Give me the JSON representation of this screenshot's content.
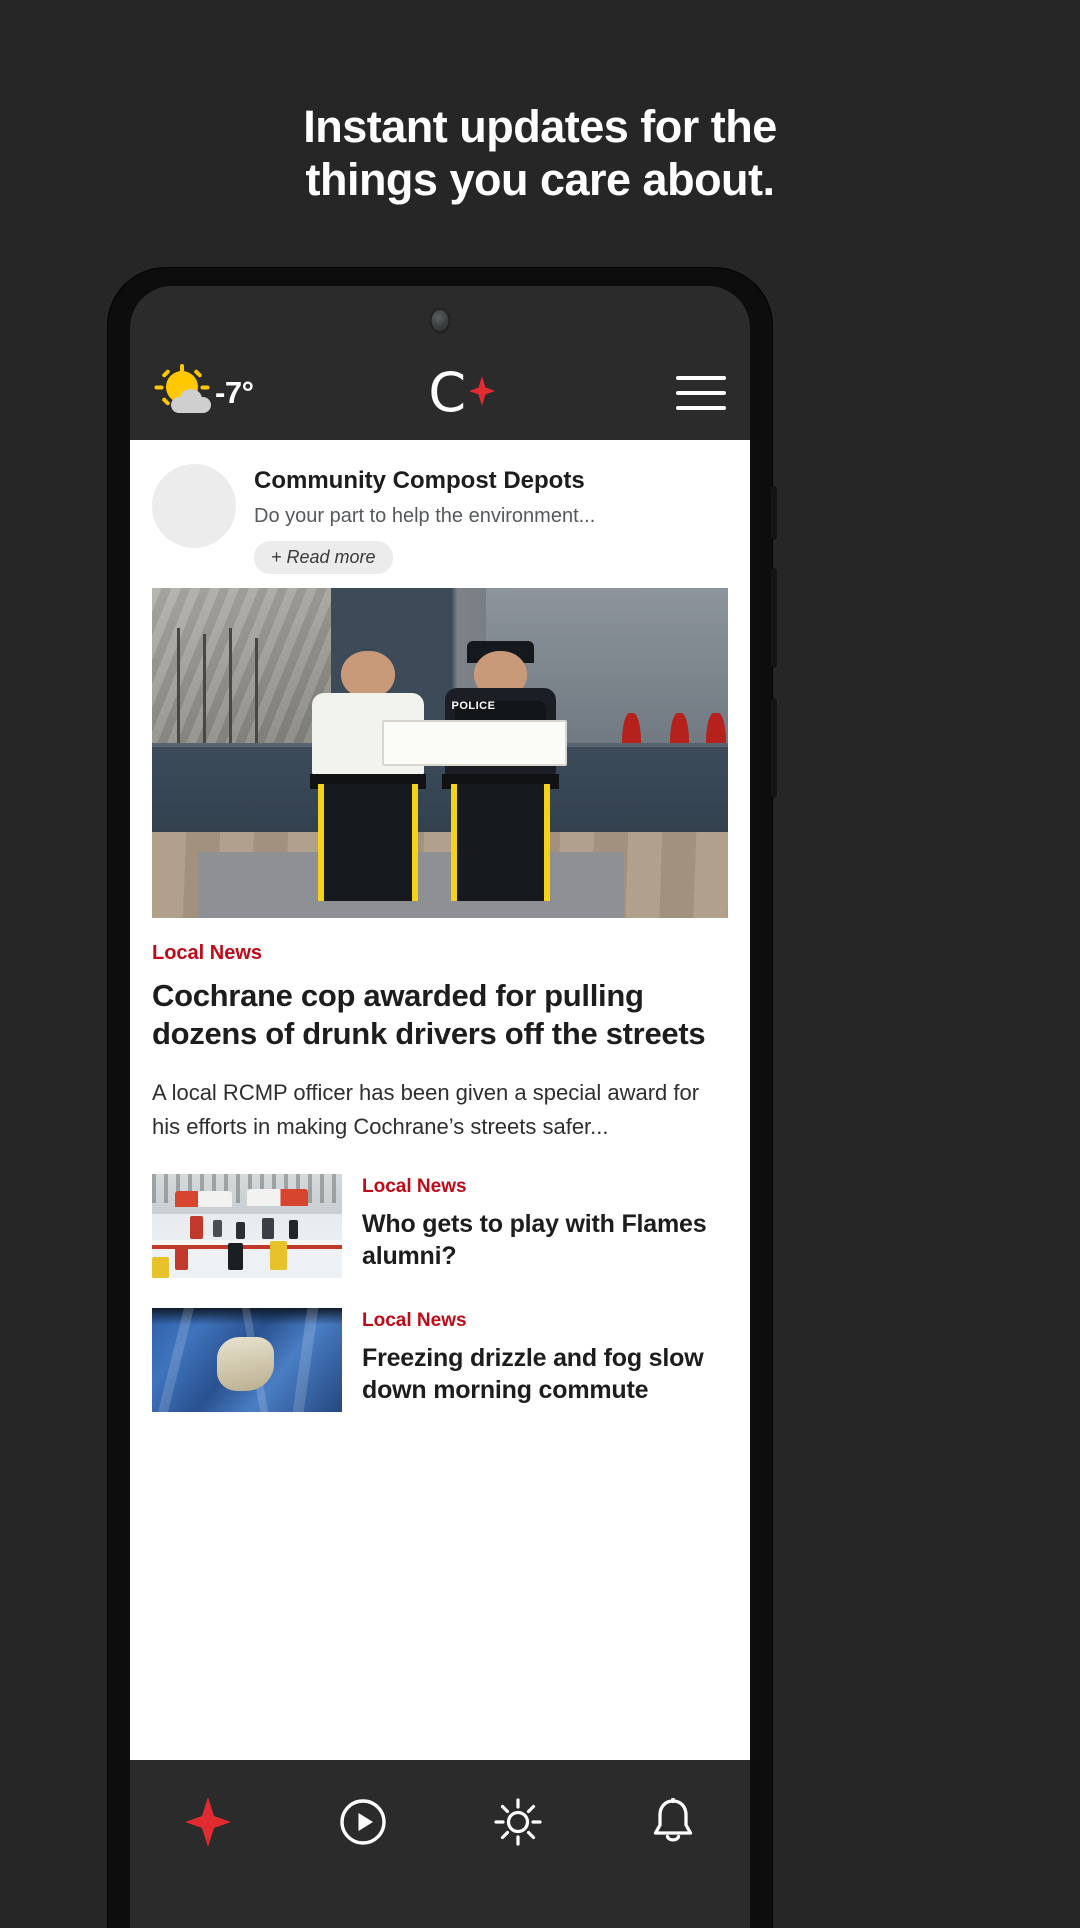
{
  "promo": {
    "headline_line1": "Instant updates for the",
    "headline_line2": "things you care about."
  },
  "app": {
    "header": {
      "weather_temp": "-7°",
      "weather_icon": "sun-behind-cloud-icon",
      "logo_letter": "C",
      "logo_accent_color": "#E02B31",
      "menu_icon": "hamburger-menu-icon"
    },
    "promo_card": {
      "title": "Community Compost Depots",
      "subtitle": "Do your part to help the environment...",
      "read_more_label": "+ Read more"
    },
    "featured_article": {
      "category": "Local News",
      "title": "Cochrane cop awarded for pulling dozens of drunk drivers off the streets",
      "excerpt": "A local RCMP officer has been given a special award for his efforts in making Cochrane’s streets safer...",
      "photo_caption_text": "POLICE"
    },
    "article_list": [
      {
        "category": "Local News",
        "title": "Who gets to play with Flames alumni?"
      },
      {
        "category": "Local News",
        "title": "Freezing drizzle and fog slow down morning commute"
      }
    ],
    "bottom_nav": [
      {
        "icon": "sparkle-icon",
        "color": "#E02B31"
      },
      {
        "icon": "play-circle-icon",
        "color": "#FFFFFF"
      },
      {
        "icon": "weather-sun-icon",
        "color": "#FFFFFF"
      },
      {
        "icon": "bell-icon",
        "color": "#FFFFFF"
      }
    ]
  },
  "colors": {
    "background": "#262626",
    "accent_red": "#C00A18",
    "brand_red": "#E02B31",
    "app_chrome": "#2B2B2B"
  }
}
